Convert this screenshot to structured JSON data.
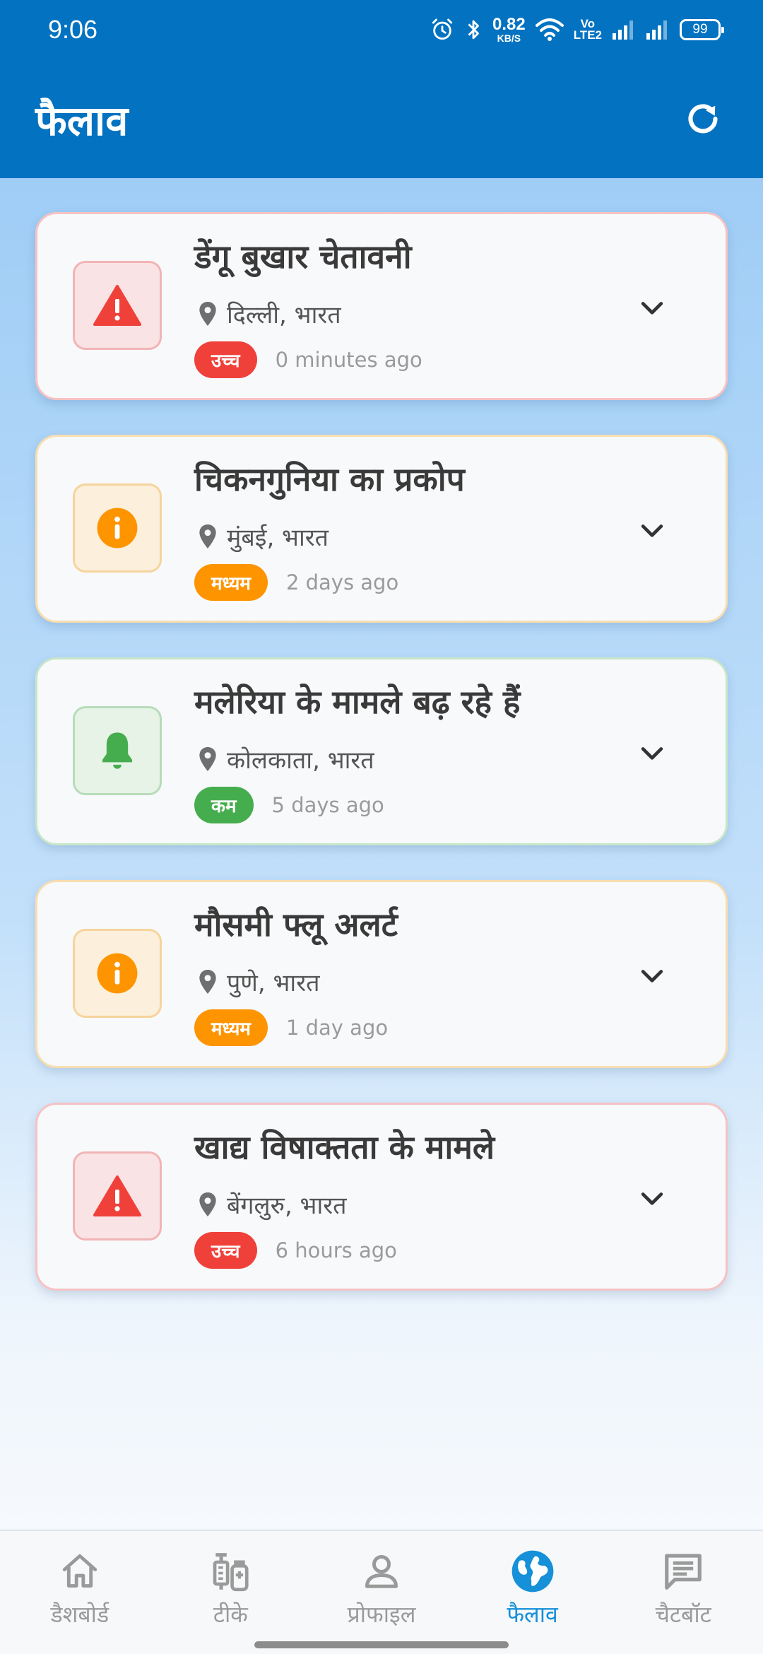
{
  "status_bar": {
    "time": "9:06",
    "net_speed_value": "0.82",
    "net_speed_unit": "KB/S",
    "volte_top": "Vo",
    "volte_bottom": "LTE2",
    "battery": "99"
  },
  "app_bar": {
    "title": "फैलाव",
    "refresh_icon": "refresh-icon"
  },
  "alerts": [
    {
      "title": "डेंगू बुखार चेतावनी",
      "location": "दिल्ली, भारत",
      "severity": "उच्च",
      "time_ago": "0 minutes ago",
      "icon": "warning-triangle-icon",
      "severity_color": "#f0403a"
    },
    {
      "title": "चिकनगुनिया का प्रकोप",
      "location": "मुंबई, भारत",
      "severity": "मध्यम",
      "time_ago": "2 days ago",
      "icon": "info-icon",
      "severity_color": "#fd9400"
    },
    {
      "title": "मलेरिया के मामले बढ़ रहे हैं",
      "location": "कोलकाता, भारत",
      "severity": "कम",
      "time_ago": "5 days ago",
      "icon": "bell-icon",
      "severity_color": "#46ad4f"
    },
    {
      "title": "मौसमी फ्लू अलर्ट",
      "location": "पुणे, भारत",
      "severity": "मध्यम",
      "time_ago": "1 day ago",
      "icon": "info-icon",
      "severity_color": "#fd9400"
    },
    {
      "title": "खाद्य विषाक्तता के मामले",
      "location": "बेंगलुरु, भारत",
      "severity": "उच्च",
      "time_ago": "6 hours ago",
      "icon": "warning-triangle-icon",
      "severity_color": "#f0403a"
    }
  ],
  "bottom_nav": [
    {
      "label": "डैशबोर्ड",
      "icon": "home-icon",
      "active": false
    },
    {
      "label": "टीके",
      "icon": "vaccine-icon",
      "active": false
    },
    {
      "label": "प्रोफाइल",
      "icon": "person-icon",
      "active": false
    },
    {
      "label": "फैलाव",
      "icon": "globe-icon",
      "active": true
    },
    {
      "label": "चैटबॉट",
      "icon": "chat-icon",
      "active": false
    }
  ],
  "colors": {
    "primary": "#0272c1",
    "active_nav": "#1590d9",
    "high": "#f0403a",
    "medium": "#fd9400",
    "low": "#46ad4f"
  }
}
